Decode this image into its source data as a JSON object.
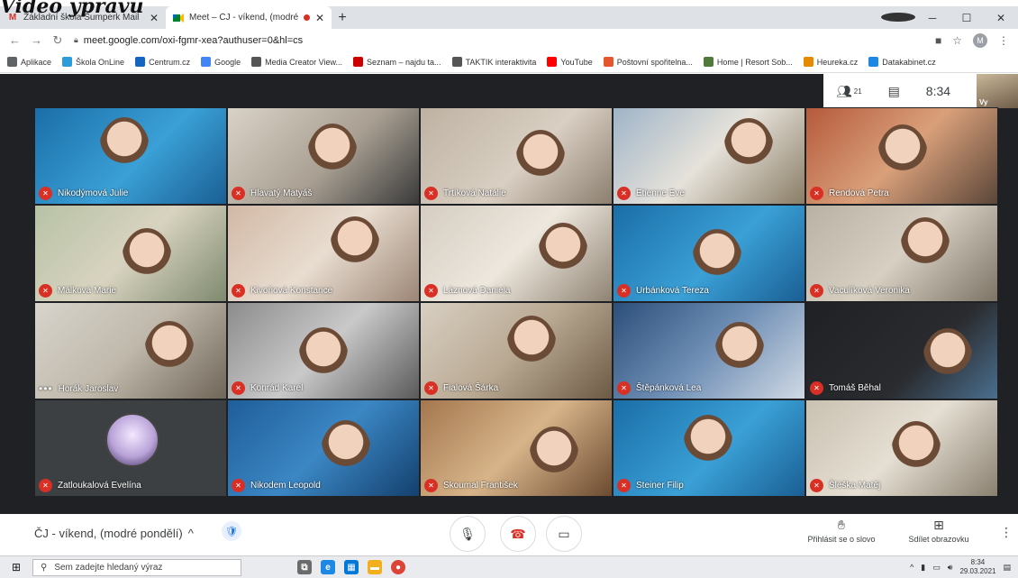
{
  "overlay_title": "Video ypravu",
  "tabs": [
    {
      "label": "Základní škola Šumperk Mail",
      "favicon": "gmail-icon",
      "active": false
    },
    {
      "label": "Meet – ČJ - víkend, (modré p",
      "favicon": "meet-icon",
      "active": true,
      "recording": true
    }
  ],
  "address": {
    "url": "meet.google.com/oxi-fgmr-xea?authuser=0&hl=cs",
    "profile_initial": "M"
  },
  "bookmarks": [
    {
      "label": "Aplikace",
      "icon": "apps-icon",
      "color": "#5f6368"
    },
    {
      "label": "Škola OnLine",
      "icon": "skola-icon",
      "color": "#2d9cdb"
    },
    {
      "label": "Centrum.cz",
      "icon": "centrum-icon",
      "color": "#1565c0"
    },
    {
      "label": "Google",
      "icon": "google-icon",
      "color": "#4285f4"
    },
    {
      "label": "Media Creator View...",
      "icon": "globe-icon",
      "color": "#555555"
    },
    {
      "label": "Seznam – najdu ta...",
      "icon": "seznam-icon",
      "color": "#cc0000"
    },
    {
      "label": "TAKTIK interaktivita",
      "icon": "globe-icon",
      "color": "#555555"
    },
    {
      "label": "YouTube",
      "icon": "youtube-icon",
      "color": "#ff0000"
    },
    {
      "label": "Poštovní spořitelna...",
      "icon": "ps-icon",
      "color": "#e4572e"
    },
    {
      "label": "Home | Resort Sob...",
      "icon": "resort-icon",
      "color": "#4f7a3a"
    },
    {
      "label": "Heureka.cz",
      "icon": "heureka-icon",
      "color": "#e68a00"
    },
    {
      "label": "Datakabinet.cz",
      "icon": "datakabinet-icon",
      "color": "#1e88e5"
    }
  ],
  "top_info": {
    "participants": "21",
    "time": "8:34",
    "self_label": "Vy"
  },
  "participants": [
    {
      "name": "Nikodýmová Julie",
      "muted": true,
      "bg": "linear-gradient(135deg,#1b6ea8,#3aa0d6 55%,#1a5f94)"
    },
    {
      "name": "Hlavatý Matyáš",
      "muted": true,
      "bg": "linear-gradient(135deg,#d9d2c6,#a89f92 55%,#3a3a3a)"
    },
    {
      "name": "Trtíková Natálie",
      "muted": true,
      "bg": "linear-gradient(135deg,#bdb2a2,#d9cfc2 55%,#8c7f70)"
    },
    {
      "name": "Etienne Eve",
      "muted": true,
      "bg": "linear-gradient(135deg,#9fb4c8,#e6e2da 50%,#8a7d66)"
    },
    {
      "name": "Rendová Petra",
      "muted": true,
      "bg": "linear-gradient(135deg,#b55a3c,#d9a07a 50%,#5a4638)"
    },
    {
      "name": "Málková Marie",
      "muted": true,
      "bg": "linear-gradient(135deg,#b7c2a5,#d8d3c0 50%,#7f8a6f)"
    },
    {
      "name": "Kivoňová Konstance",
      "muted": true,
      "bg": "linear-gradient(135deg,#d2b8a5,#e8ddd0 50%,#9c8676)"
    },
    {
      "name": "Láznová Daniela",
      "muted": true,
      "bg": "linear-gradient(135deg,#d5cdc2,#ede7dd 50%,#8f8373)"
    },
    {
      "name": "Urbánková Tereza",
      "muted": true,
      "bg": "linear-gradient(135deg,#1b6ea8,#3aa0d6 55%,#1a5f94)"
    },
    {
      "name": "Vaculíková Veronika",
      "muted": true,
      "bg": "linear-gradient(135deg,#b9b2a4,#d7d0c2 50%,#7d7466)"
    },
    {
      "name": "Horák Jaroslav",
      "muted": false,
      "bg": "linear-gradient(135deg,#d8d4cc,#bfb8ab 50%,#6f6658)"
    },
    {
      "name": "Konrád Karel",
      "muted": true,
      "bg": "linear-gradient(135deg,#8c8c8c,#c9c9c9 50%,#5a5a5a)"
    },
    {
      "name": "Fialová Šárka",
      "muted": true,
      "bg": "linear-gradient(135deg,#d8cfc2,#b9a993 50%,#6d5a45)"
    },
    {
      "name": "Štěpánková Lea",
      "muted": true,
      "bg": "linear-gradient(135deg,#2c4f7a,#6f8fb5 50%,#d0d9e4)"
    },
    {
      "name": "Tomáš Běhal",
      "muted": true,
      "bg": "linear-gradient(135deg,#202124,#2a2b2e 60%,#4a6f8f)"
    },
    {
      "name": "Zatloukalová Evelína",
      "muted": true,
      "bg": "#3c4043",
      "avatar": true
    },
    {
      "name": "Nikodem Leopold",
      "muted": true,
      "bg": "linear-gradient(135deg,#1f5e9a,#3b87c4 50%,#14406e)"
    },
    {
      "name": "Skoumal František",
      "muted": true,
      "bg": "linear-gradient(135deg,#a4774f,#d7b489 50%,#6b4a30)"
    },
    {
      "name": "Steiner Filip",
      "muted": true,
      "bg": "linear-gradient(135deg,#1b6ea8,#3aa0d6 55%,#1a5f94)"
    },
    {
      "name": "Šléška Matěj",
      "muted": true,
      "bg": "linear-gradient(135deg,#c9c1b1,#e5dfd3 50%,#8a8070)"
    }
  ],
  "callbar": {
    "meeting_name": "ČJ - víkend, (modré pondělí)",
    "raise_hand": "Přihlásit se o slovo",
    "share_screen": "Sdílet obrazovku"
  },
  "taskbar": {
    "search_placeholder": "Sem zadejte hledaný výraz",
    "time": "8:34",
    "date": "29.03.2021"
  }
}
